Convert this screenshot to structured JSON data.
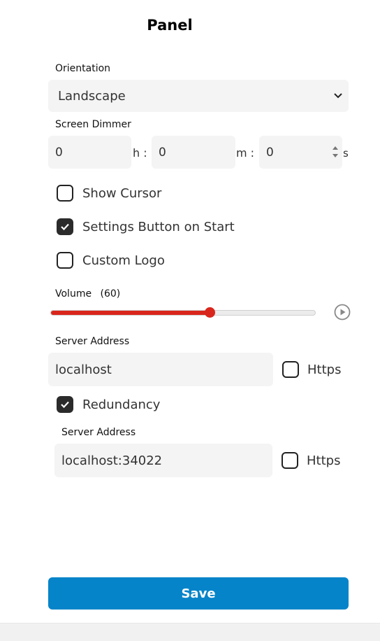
{
  "header": {
    "title": "Panel"
  },
  "orientation": {
    "label": "Orientation",
    "selected": "Landscape",
    "icon": "chevron-down-icon"
  },
  "screen_dimmer": {
    "label": "Screen Dimmer",
    "hours": "0",
    "minutes": "0",
    "seconds": "0",
    "hours_unit": "h :",
    "minutes_unit": "m :",
    "seconds_unit": "s"
  },
  "options": {
    "show_cursor": {
      "label": "Show Cursor",
      "checked": false
    },
    "settings_button": {
      "label": "Settings Button on Start",
      "checked": true
    },
    "custom_logo": {
      "label": "Custom Logo",
      "checked": false
    }
  },
  "volume": {
    "label": "Volume",
    "value_text": "(60)",
    "value": 60,
    "max": 100,
    "accent": "#d9261c"
  },
  "server": {
    "label": "Server Address",
    "value": "localhost",
    "https_label": "Https",
    "https_checked": false
  },
  "redundancy": {
    "label": "Redundancy",
    "checked": true,
    "server_label": "Server Address",
    "server_value": "localhost:34022",
    "https_label": "Https",
    "https_checked": false
  },
  "actions": {
    "save_label": "Save",
    "save_color": "#0584c9"
  }
}
